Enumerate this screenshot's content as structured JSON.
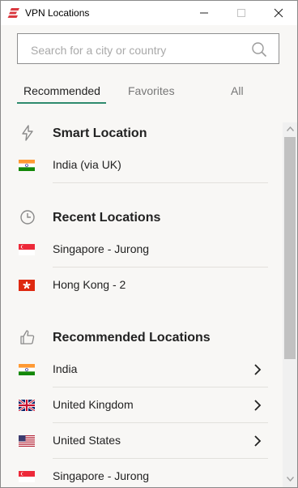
{
  "window": {
    "title": "VPN Locations",
    "minimize_icon": "minimize-icon",
    "maximize_icon": "maximize-icon",
    "close_icon": "close-icon"
  },
  "search": {
    "placeholder": "Search for a city or country",
    "value": ""
  },
  "tabs": [
    {
      "label": "Recommended",
      "active": true
    },
    {
      "label": "Favorites",
      "active": false
    },
    {
      "label": "All",
      "active": false
    }
  ],
  "sections": {
    "smart": {
      "title": "Smart Location",
      "icon": "lightning-icon"
    },
    "recent": {
      "title": "Recent Locations",
      "icon": "clock-icon"
    },
    "recommended": {
      "title": "Recommended Locations",
      "icon": "thumbs-up-icon"
    }
  },
  "smart_items": [
    {
      "name": "India (via UK)",
      "flag": "india"
    }
  ],
  "recent_items": [
    {
      "name": "Singapore - Jurong",
      "flag": "singapore"
    },
    {
      "name": "Hong Kong - 2",
      "flag": "hong-kong"
    }
  ],
  "recommended_items": [
    {
      "name": "India",
      "flag": "india",
      "expandable": true
    },
    {
      "name": "United Kingdom",
      "flag": "uk",
      "expandable": true
    },
    {
      "name": "United States",
      "flag": "usa",
      "expandable": true
    },
    {
      "name": "Singapore - Jurong",
      "flag": "singapore",
      "expandable": false
    }
  ],
  "colors": {
    "accent": "#2e8b6e",
    "brand": "#da3940",
    "background": "#f8f7f5"
  }
}
